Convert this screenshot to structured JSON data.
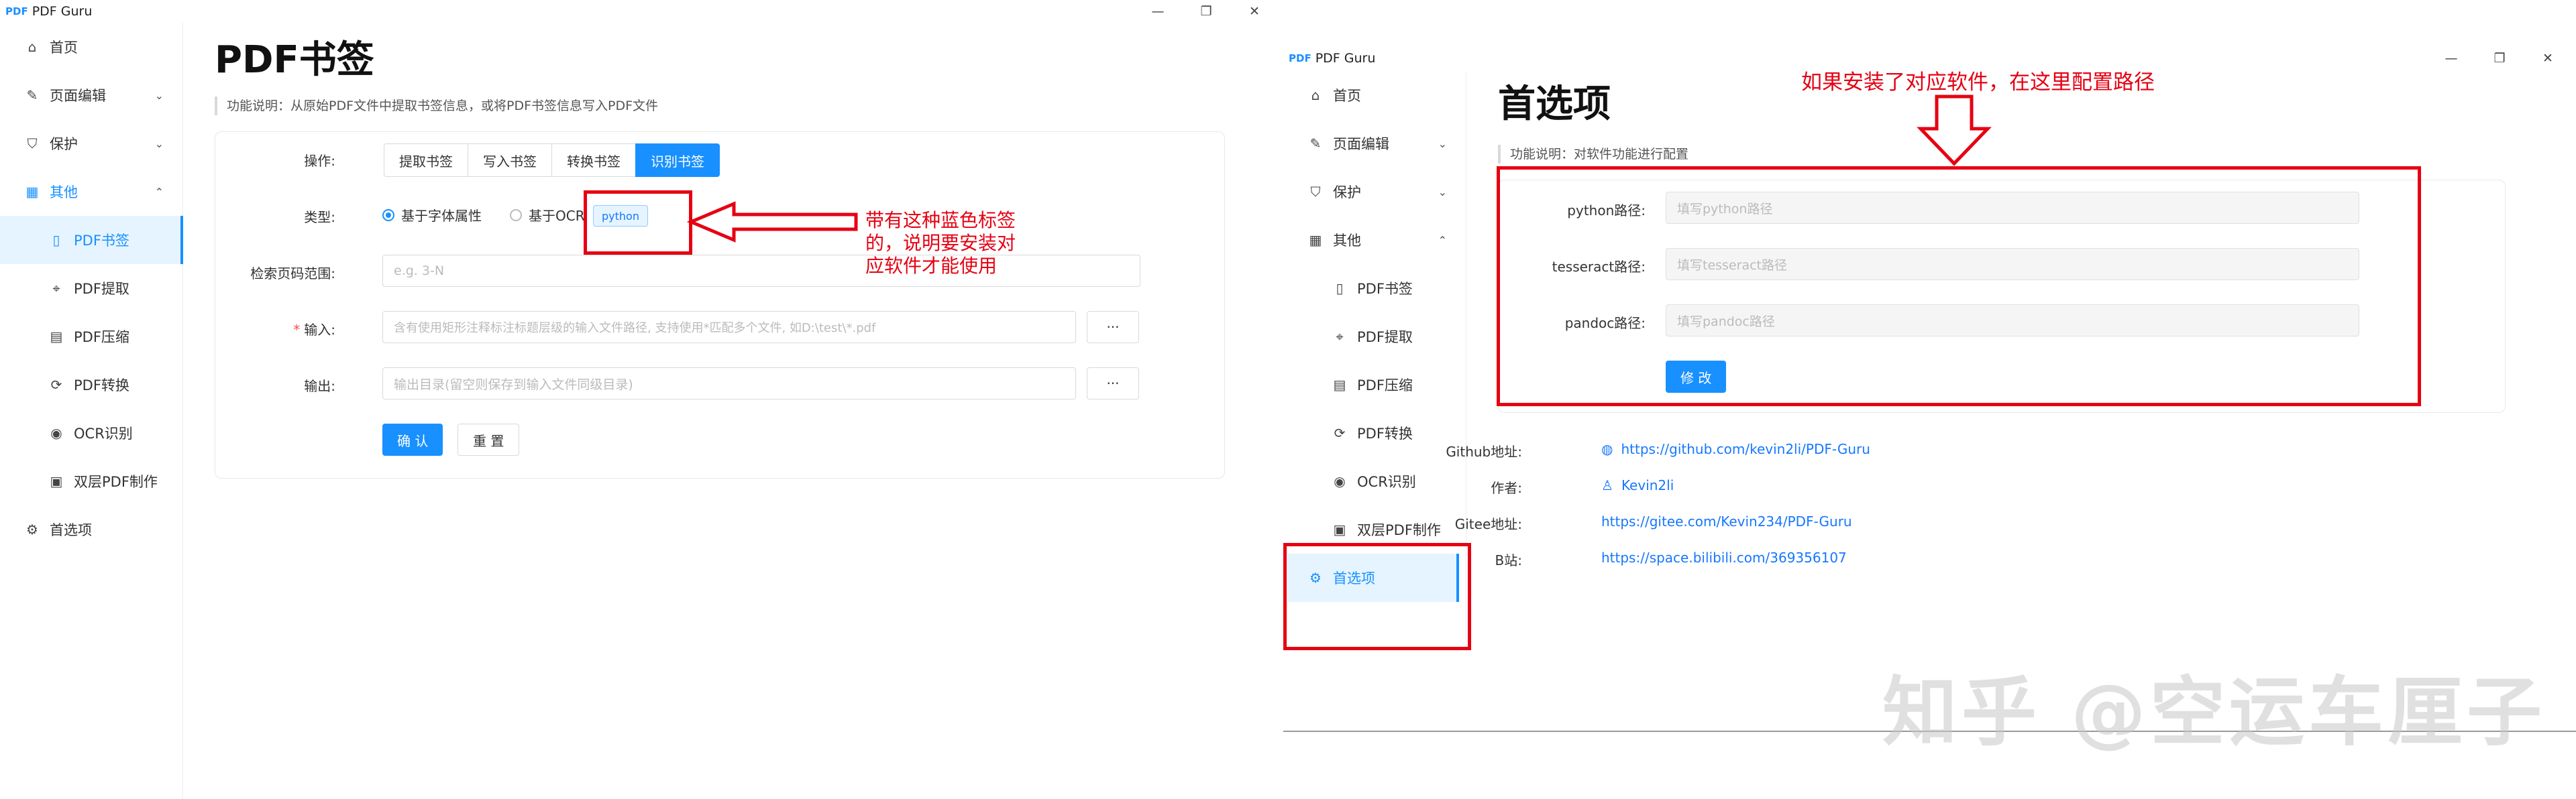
{
  "left": {
    "app_logo": "PDF",
    "app_name": "PDF Guru",
    "window_controls": {
      "minimize": "—",
      "maximize": "❐",
      "close": "✕"
    },
    "nav": [
      {
        "label": "首页",
        "icon": "home-icon",
        "glyph": "⌂"
      },
      {
        "label": "页面编辑",
        "icon": "edit-icon",
        "glyph": "✎",
        "chevron": "⌄"
      },
      {
        "label": "保护",
        "icon": "shield-icon",
        "glyph": "⛉",
        "chevron": "⌄"
      },
      {
        "label": "其他",
        "icon": "grid-icon",
        "glyph": "▦",
        "chevron": "⌃"
      },
      {
        "label": "PDF书签",
        "icon": "bookmark-file-icon",
        "glyph": "▯"
      },
      {
        "label": "PDF提取",
        "icon": "extract-icon",
        "glyph": "⌖"
      },
      {
        "label": "PDF压缩",
        "icon": "compress-file-icon",
        "glyph": "▤"
      },
      {
        "label": "PDF转换",
        "icon": "convert-icon",
        "glyph": "⟳"
      },
      {
        "label": "OCR识别",
        "icon": "eye-icon",
        "glyph": "◉"
      },
      {
        "label": "双层PDF制作",
        "icon": "layers-file-icon",
        "glyph": "▣"
      },
      {
        "label": "首选项",
        "icon": "gear-icon",
        "glyph": "⚙"
      }
    ],
    "page_title": "PDF书签",
    "description": "功能说明：从原始PDF文件中提取书签信息，或将PDF书签信息写入PDF文件",
    "form": {
      "op_label": "操作:",
      "ops": [
        "提取书签",
        "写入书签",
        "转换书签",
        "识别书签"
      ],
      "type_label": "类型:",
      "type_options": [
        "基于字体属性",
        "基于OCR"
      ],
      "tag": "python",
      "range_label": "检索页码范围:",
      "range_placeholder": "e.g. 3-N",
      "input_label": "输入:",
      "input_placeholder": "含有使用矩形注释标注标题层级的输入文件路径, 支持使用*匹配多个文件, 如D:\\test\\*.pdf",
      "output_label": "输出:",
      "output_placeholder": "输出目录(留空则保存到输入文件同级目录)",
      "browse": "···",
      "confirm": "确 认",
      "reset": "重 置"
    },
    "annotation": "带有这种蓝色标签的，说明要安装对应软件才能使用"
  },
  "right": {
    "app_logo": "PDF",
    "app_name": "PDF Guru",
    "window_controls": {
      "minimize": "—",
      "maximize": "❐",
      "close": "✕"
    },
    "nav": [
      {
        "label": "首页",
        "icon": "home-icon",
        "glyph": "⌂"
      },
      {
        "label": "页面编辑",
        "icon": "edit-icon",
        "glyph": "✎",
        "chevron": "⌄"
      },
      {
        "label": "保护",
        "icon": "shield-icon",
        "glyph": "⛉",
        "chevron": "⌄"
      },
      {
        "label": "其他",
        "icon": "grid-icon",
        "glyph": "▦",
        "chevron": "⌃"
      },
      {
        "label": "PDF书签",
        "icon": "bookmark-file-icon",
        "glyph": "▯"
      },
      {
        "label": "PDF提取",
        "icon": "extract-icon",
        "glyph": "⌖"
      },
      {
        "label": "PDF压缩",
        "icon": "compress-file-icon",
        "glyph": "▤"
      },
      {
        "label": "PDF转换",
        "icon": "convert-icon",
        "glyph": "⟳"
      },
      {
        "label": "OCR识别",
        "icon": "eye-icon",
        "glyph": "◉"
      },
      {
        "label": "双层PDF制作",
        "icon": "layers-file-icon",
        "glyph": "▣"
      },
      {
        "label": "首选项",
        "icon": "gear-icon",
        "glyph": "⚙"
      }
    ],
    "page_title": "首选项",
    "description": "功能说明：对软件功能进行配置",
    "form": {
      "python_label": "python路径:",
      "python_placeholder": "填写python路径",
      "tesseract_label": "tesseract路径:",
      "tesseract_placeholder": "填写tesseract路径",
      "pandoc_label": "pandoc路径:",
      "pandoc_placeholder": "填写pandoc路径",
      "modify": "修 改"
    },
    "annotation": "如果安装了对应软件，在这里配置路径",
    "info": {
      "github_label": "Github地址:",
      "github_url": "https://github.com/kevin2li/PDF-Guru",
      "author_label": "作者:",
      "author": "Kevin2li",
      "gitee_label": "Gitee地址:",
      "gitee_url": "https://gitee.com/Kevin234/PDF-Guru",
      "bilibili_label": "B站:",
      "bilibili_url": "https://space.bilibili.com/369356107"
    }
  },
  "watermark": "知乎 @空运车厘子",
  "colors": {
    "accent": "#1890ff",
    "annotation_red": "#e60012"
  }
}
